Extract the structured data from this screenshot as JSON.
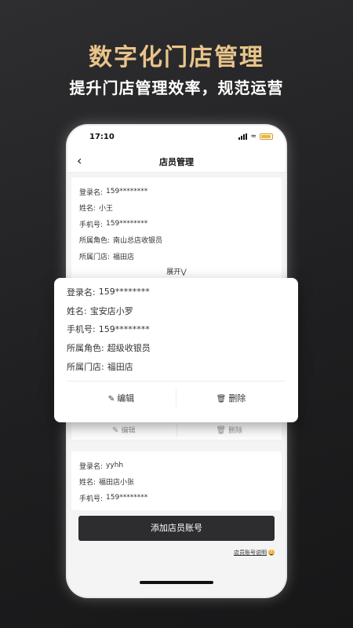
{
  "promo": {
    "headline": "数字化门店管理",
    "subline": "提升门店管理效率，规范运营"
  },
  "status": {
    "time": "17:10"
  },
  "nav": {
    "title": "店员管理"
  },
  "labels": {
    "login": "登录名:",
    "name": "姓名:",
    "phone": "手机号:",
    "role": "所属角色:",
    "store": "所属门店:",
    "expand": "展开",
    "edit": "编辑",
    "delete": "删除"
  },
  "staff": [
    {
      "login": "159********",
      "name": "小王",
      "phone": "159********",
      "role": "南山总店收银员",
      "store": "福田店"
    },
    {
      "login": "159********",
      "name": "宝安店小罗",
      "phone": "159********",
      "role": "超级收银员",
      "store": "福田店"
    },
    {
      "login": "yyhh",
      "name": "福田店小张",
      "phone": "159********"
    }
  ],
  "add_button": "添加店员账号",
  "help_link": "店员账号说明",
  "colors": {
    "accent": "#e9c48a",
    "button": "#2d2d2f"
  }
}
